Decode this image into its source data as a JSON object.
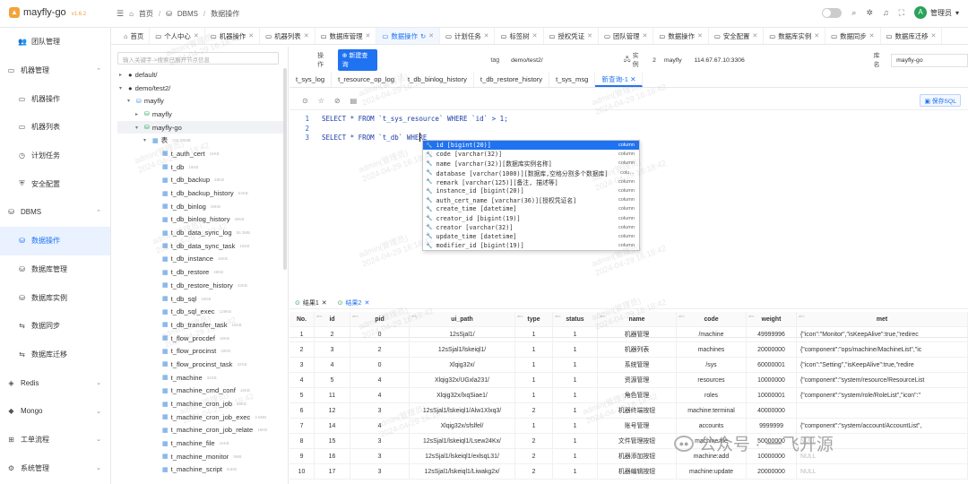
{
  "app": {
    "name": "mayfly-go",
    "version": "v1.6.2"
  },
  "breadcrumb": [
    "首页",
    "DBMS",
    "数据操作"
  ],
  "user": {
    "initial": "A",
    "name": "管理员"
  },
  "sidebar": [
    {
      "label": "团队管理",
      "level": "sub",
      "icon": "team-icon"
    },
    {
      "label": "机器管理",
      "level": "top",
      "icon": "monitor-icon",
      "expanded": true
    },
    {
      "label": "机器操作",
      "level": "sub",
      "icon": "monitor-icon"
    },
    {
      "label": "机器列表",
      "level": "sub",
      "icon": "monitor-icon"
    },
    {
      "label": "计划任务",
      "level": "sub",
      "icon": "clock-icon"
    },
    {
      "label": "安全配置",
      "level": "sub",
      "icon": "shield-icon"
    },
    {
      "label": "DBMS",
      "level": "top",
      "icon": "database-icon",
      "expanded": true
    },
    {
      "label": "数据操作",
      "level": "sub",
      "icon": "database-icon",
      "active": true
    },
    {
      "label": "数据库管理",
      "level": "sub",
      "icon": "database-icon"
    },
    {
      "label": "数据库实例",
      "level": "sub",
      "icon": "database-icon"
    },
    {
      "label": "数据同步",
      "level": "sub",
      "icon": "sync-icon"
    },
    {
      "label": "数据库迁移",
      "level": "sub",
      "icon": "sync-icon"
    },
    {
      "label": "Redis",
      "level": "top",
      "icon": "redis-icon",
      "expanded": false
    },
    {
      "label": "Mongo",
      "level": "top",
      "icon": "mongo-icon",
      "expanded": false
    },
    {
      "label": "工单流程",
      "level": "top",
      "icon": "flow-icon",
      "expanded": false
    },
    {
      "label": "系统管理",
      "level": "top",
      "icon": "gear-icon",
      "expanded": false
    }
  ],
  "tabs": [
    {
      "label": "首页",
      "closable": false
    },
    {
      "label": "个人中心",
      "closable": true
    },
    {
      "label": "机器操作",
      "closable": true
    },
    {
      "label": "机器列表",
      "closable": true
    },
    {
      "label": "数据库管理",
      "closable": true
    },
    {
      "label": "数据操作",
      "closable": true,
      "active": true
    },
    {
      "label": "计划任务",
      "closable": true
    },
    {
      "label": "标签树",
      "closable": true
    },
    {
      "label": "授权凭证",
      "closable": true
    },
    {
      "label": "团队管理",
      "closable": true
    },
    {
      "label": "数据操作",
      "closable": true
    },
    {
      "label": "安全配置",
      "closable": true
    },
    {
      "label": "数据库实例",
      "closable": true
    },
    {
      "label": "数据同步",
      "closable": true
    },
    {
      "label": "数据库迁移",
      "closable": true
    }
  ],
  "tree": {
    "search_placeholder": "输入关键字->搜索已展开节点信息",
    "nodes": [
      {
        "label": "default/",
        "depth": 0,
        "arrow": "▸",
        "kind": "tag"
      },
      {
        "label": "demo/test2/",
        "depth": 0,
        "arrow": "▾",
        "kind": "tag"
      },
      {
        "label": "mayfly",
        "depth": 1,
        "arrow": "▾",
        "kind": "inst"
      },
      {
        "label": "mayfly",
        "depth": 2,
        "arrow": "▸",
        "kind": "db"
      },
      {
        "label": "mayfly-go",
        "depth": 2,
        "arrow": "▾",
        "kind": "db",
        "selected": true
      },
      {
        "label": "表",
        "depth": 3,
        "arrow": "▾",
        "kind": "folder",
        "cap": "216.05MB"
      },
      {
        "label": "t_auth_cert",
        "depth": 4,
        "kind": "table",
        "cap": "16KB"
      },
      {
        "label": "t_db",
        "depth": 4,
        "kind": "table",
        "cap": "16KB"
      },
      {
        "label": "t_db_backup",
        "depth": 4,
        "kind": "table",
        "cap": "48KB"
      },
      {
        "label": "t_db_backup_history",
        "depth": 4,
        "kind": "table",
        "cap": "64KB"
      },
      {
        "label": "t_db_binlog",
        "depth": 4,
        "kind": "table",
        "cap": "48KB"
      },
      {
        "label": "t_db_binlog_history",
        "depth": 4,
        "kind": "table",
        "cap": "48KB"
      },
      {
        "label": "t_db_data_sync_log",
        "depth": 4,
        "kind": "table",
        "cap": "55.3MB"
      },
      {
        "label": "t_db_data_sync_task",
        "depth": 4,
        "kind": "table",
        "cap": "16KB"
      },
      {
        "label": "t_db_instance",
        "depth": 4,
        "kind": "table",
        "cap": "16KB"
      },
      {
        "label": "t_db_restore",
        "depth": 4,
        "kind": "table",
        "cap": "48KB"
      },
      {
        "label": "t_db_restore_history",
        "depth": 4,
        "kind": "table",
        "cap": "32KB"
      },
      {
        "label": "t_db_sql",
        "depth": 4,
        "kind": "table",
        "cap": "16KB"
      },
      {
        "label": "t_db_sql_exec",
        "depth": 4,
        "kind": "table",
        "cap": "128KB"
      },
      {
        "label": "t_db_transfer_task",
        "depth": 4,
        "kind": "table",
        "cap": "16KB"
      },
      {
        "label": "t_flow_procdef",
        "depth": 4,
        "kind": "table",
        "cap": "16KB"
      },
      {
        "label": "t_flow_procinst",
        "depth": 4,
        "kind": "table",
        "cap": "32KB"
      },
      {
        "label": "t_flow_procinst_task",
        "depth": 4,
        "kind": "table",
        "cap": "32KB"
      },
      {
        "label": "t_machine",
        "depth": 4,
        "kind": "table",
        "cap": "32KB"
      },
      {
        "label": "t_machine_cmd_conf",
        "depth": 4,
        "kind": "table",
        "cap": "16KB"
      },
      {
        "label": "t_machine_cron_job",
        "depth": 4,
        "kind": "table",
        "cap": "16KB"
      },
      {
        "label": "t_machine_cron_job_exec",
        "depth": 4,
        "kind": "table",
        "cap": "3.5MB"
      },
      {
        "label": "t_machine_cron_job_relate",
        "depth": 4,
        "kind": "table",
        "cap": "16KB"
      },
      {
        "label": "t_machine_file",
        "depth": 4,
        "kind": "table",
        "cap": "16KB"
      },
      {
        "label": "t_machine_monitor",
        "depth": 4,
        "kind": "table",
        "cap": "9MB"
      },
      {
        "label": "t_machine_script",
        "depth": 4,
        "kind": "table",
        "cap": "64KB"
      }
    ]
  },
  "infobar": {
    "op_label": "操作",
    "new_query": "新建查询",
    "tag_label": "tag",
    "tag_value": "demo/test2/",
    "instance_label": "实例",
    "instance_id": "2",
    "instance_name": "mayfly",
    "instance_addr": "114.67.67.10:3306",
    "db_label": "库名",
    "db_value": "mayfly-go"
  },
  "sql_tabs": [
    {
      "label": "t_sys_log"
    },
    {
      "label": "t_resource_op_log"
    },
    {
      "label": "t_db_binlog_history"
    },
    {
      "label": "t_db_restore_history"
    },
    {
      "label": "t_sys_msg"
    },
    {
      "label": "新查询-1",
      "active": true,
      "closable": true
    }
  ],
  "save_sql": "保存SQL",
  "editor": [
    {
      "n": "1",
      "text": "SELECT * FROM `t_sys_resource` WHERE `id` > 1;"
    },
    {
      "n": "2",
      "text": ""
    },
    {
      "n": "3",
      "text": "SELECT * FROM `t_db` WHERE "
    }
  ],
  "autocomplete": [
    {
      "text": "id  [bigint(20)]",
      "kind": "column",
      "selected": true
    },
    {
      "text": "code  [varchar(32)]",
      "kind": "column"
    },
    {
      "text": "name  [varchar(32)][数据库实例名称]",
      "kind": "column"
    },
    {
      "text": "database  [varchar(1000)][数据库,空格分割多个数据库]",
      "kind": "colu…"
    },
    {
      "text": "remark  [varchar(125)][备注, 描述等]",
      "kind": "column"
    },
    {
      "text": "instance_id  [bigint(20)]",
      "kind": "column"
    },
    {
      "text": "auth_cert_name  [varchar(36)][授权凭证名]",
      "kind": "column"
    },
    {
      "text": "create_time  [datetime]",
      "kind": "column"
    },
    {
      "text": "creator_id  [bigint(19)]",
      "kind": "column"
    },
    {
      "text": "creator  [varchar(32)]",
      "kind": "column"
    },
    {
      "text": "update_time  [datetime]",
      "kind": "column"
    },
    {
      "text": "modifier_id  [bigint(19)]",
      "kind": "column"
    }
  ],
  "result_tabs": [
    {
      "label": "结果1",
      "closable": true
    },
    {
      "label": "结果2",
      "closable": true,
      "active": true
    }
  ],
  "grid": {
    "columns": [
      "No.",
      "id",
      "pid",
      "ui_path",
      "type",
      "status",
      "name",
      "code",
      "weight",
      "met"
    ],
    "types": [
      "",
      "abc",
      "abc",
      "abc",
      "abc",
      "abc",
      "abc",
      "abc",
      "abc",
      "abc"
    ],
    "rows": [
      [
        "1",
        "2",
        "0",
        "12sSjal1/",
        "1",
        "1",
        "机器管理",
        "/machine",
        "49999996",
        "{\"icon\":\"Monitor\",\"isKeepAlive\":true,\"redirec"
      ],
      [
        "2",
        "3",
        "2",
        "12sSjal1/lskeiql1/",
        "1",
        "1",
        "机器列表",
        "machines",
        "20000000",
        "{\"component\":\"ops/machine/MachineList\",\"ic"
      ],
      [
        "3",
        "4",
        "0",
        "Xlqig32x/",
        "1",
        "1",
        "系统管理",
        "/sys",
        "60000001",
        "{\"icon\":\"Setting\",\"isKeepAlive\":true,\"redire"
      ],
      [
        "4",
        "5",
        "4",
        "Xlqig32x/UGxla231/",
        "1",
        "1",
        "资源管理",
        "resources",
        "10000000",
        "{\"component\":\"system/resource/ResourceList"
      ],
      [
        "5",
        "11",
        "4",
        "Xlqig32x/lxqSiae1/",
        "1",
        "1",
        "角色管理",
        "roles",
        "10000001",
        "{\"component\":\"system/role/RoleList\",\"icon\":\""
      ],
      [
        "6",
        "12",
        "3",
        "12sSjal1/lskeiql1/Alw1Xlxq3/",
        "2",
        "1",
        "机器终端按钮",
        "machine:terminal",
        "40000000",
        ""
      ],
      [
        "7",
        "14",
        "4",
        "Xlqig32x/sfslfel/",
        "1",
        "1",
        "账号管理",
        "accounts",
        "9999999",
        "{\"component\":\"system/account/AccountList\","
      ],
      [
        "8",
        "15",
        "3",
        "12sSjal1/lskeiql1/Lsew24Kx/",
        "2",
        "1",
        "文件管理按钮",
        "machine:file",
        "50000000",
        "NULL"
      ],
      [
        "9",
        "16",
        "3",
        "12sSjal1/lskeiql1/exlsqL31/",
        "2",
        "1",
        "机器添加按钮",
        "machine:add",
        "10000000",
        "NULL"
      ],
      [
        "10",
        "17",
        "3",
        "12sSjal1/lskeiql1/Liwakg2x/",
        "2",
        "1",
        "机器编辑按钮",
        "machine:update",
        "20000000",
        "NULL"
      ]
    ]
  },
  "watermark": {
    "line1": "admin(管理员)",
    "line2": "2024-04-29 16:18:42"
  },
  "brand": {
    "text": "公众号 · 一飞开源"
  }
}
